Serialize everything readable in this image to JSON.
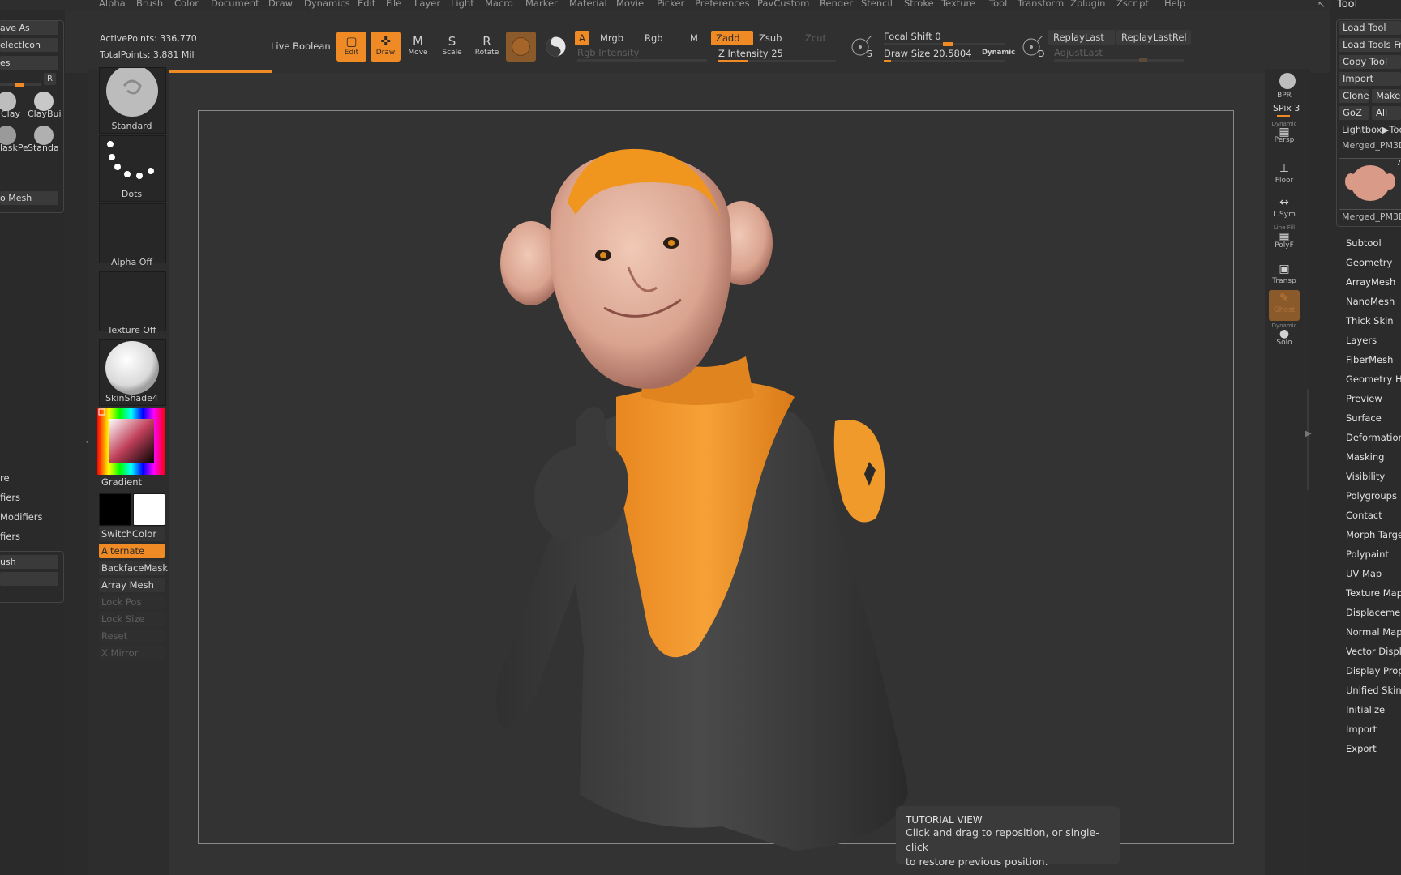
{
  "menu": [
    "Alpha",
    "Brush",
    "Color",
    "Document",
    "Draw",
    "Dynamics",
    "Edit",
    "File",
    "Layer",
    "Light",
    "Macro",
    "Marker",
    "Material",
    "Movie",
    "Picker",
    "Preferences",
    "PavCustom",
    "Render",
    "Stencil",
    "Stroke",
    "Texture",
    "Tool",
    "Transform",
    "Zplugin",
    "Zscript",
    "Help"
  ],
  "stats": {
    "active_points": "ActivePoints: 336,770",
    "total_points": "TotalPoints: 3.881 Mil"
  },
  "toolbar": {
    "live_boolean": "Live Boolean",
    "edit": "Edit",
    "draw": "Draw",
    "move": "Move",
    "scale": "Scale",
    "rotate": "Rotate",
    "a": "A",
    "mrgb": "Mrgb",
    "rgb": "Rgb",
    "m": "M",
    "zadd": "Zadd",
    "zsub": "Zsub",
    "zcut": "Zcut",
    "rgb_intensity": "Rgb Intensity",
    "z_intensity": "Z Intensity 25",
    "focal_shift": "Focal Shift 0",
    "draw_size": "Draw Size 20.5804",
    "dynamic": "Dynamic",
    "replay_last": "ReplayLast",
    "replay_last_rel": "ReplayLastRel",
    "adjust_last": "AdjustLast",
    "s_label": "S",
    "d_label": "D",
    "z_intensity_value": 25,
    "draw_size_value": 20.5804,
    "focal_shift_value": 0
  },
  "left_tray": {
    "save_as": "ave As",
    "select_icon": "electIcon",
    "es": "es",
    "r": "R",
    "brush_clay": "Clay",
    "brush_claybuild": "ClayBui",
    "brush_maskpen": "laskPe",
    "brush_standard": "Standa",
    "to_mesh": "o Mesh",
    "re": "re",
    "fiers1": "fiers",
    "modifiers": "Modifiers",
    "fiers2": "fiers",
    "ush": "ush"
  },
  "left_shelf": {
    "standard": "Standard",
    "dots": "Dots",
    "alpha_off": "Alpha Off",
    "texture_off": "Texture Off",
    "skinshade": "SkinShade4",
    "gradient": "Gradient",
    "switch_color": "SwitchColor",
    "alternate": "Alternate",
    "backface_mask": "BackfaceMask",
    "array_mesh": "Array Mesh",
    "lock_pos": "Lock Pos",
    "lock_size": "Lock Size",
    "reset": "Reset",
    "x_mirror": "X Mirror"
  },
  "right_shelf": {
    "bpr": "BPR",
    "spix": "SPix 3",
    "dynamic": "Dynamic",
    "persp": "Persp",
    "floor": "Floor",
    "lsym": "L.Sym",
    "line_fill": "Line Fill",
    "polyf": "PolyF",
    "transp": "Transp",
    "ghost": "Ghost",
    "dynamic2": "Dynamic",
    "solo": "Solo"
  },
  "tool_panel": {
    "title": "Tool",
    "load_tool": "Load Tool",
    "load_tools_from": "Load Tools Fro",
    "copy_tool": "Copy Tool",
    "import": "Import",
    "clone": "Clone",
    "make": "Make",
    "goz": "GoZ",
    "all": "All",
    "lightbox_tools": "Lightbox▶Too",
    "merged_name_top": "Merged_PM3D",
    "merged_name_thumb": "Merged_PM3D",
    "thumb_count": "7",
    "items": [
      "Subtool",
      "Geometry",
      "ArrayMesh",
      "NanoMesh",
      "Thick Skin",
      "Layers",
      "FiberMesh",
      "Geometry HD",
      "Preview",
      "Surface",
      "Deformation",
      "Masking",
      "Visibility",
      "Polygroups",
      "Contact",
      "Morph Targe",
      "Polypaint",
      "UV Map",
      "Texture Map",
      "Displacemen",
      "Normal Map",
      "Vector Displa",
      "Display Prop",
      "Unified Skin",
      "Initialize",
      "Import",
      "Export"
    ]
  },
  "tutorial": {
    "title": "TUTORIAL VIEW",
    "line1": "Click and drag to reposition, or single-click",
    "line2": "to restore previous position."
  },
  "colors": {
    "accent": "#f08a24",
    "background": "#2b2b2b",
    "canvas": "#333333"
  }
}
